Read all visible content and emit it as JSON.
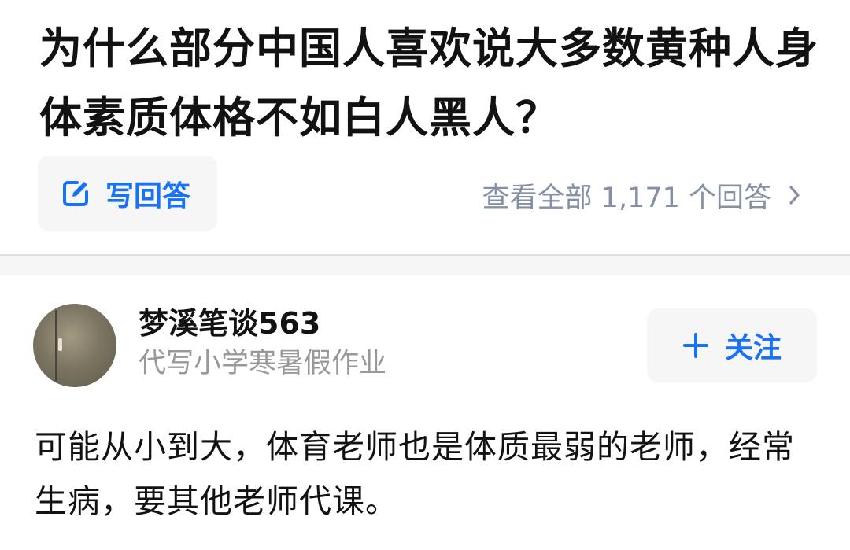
{
  "question": {
    "title": "为什么部分中国人喜欢说大多数黄种人身体素质体格不如白人黑人？"
  },
  "actions": {
    "write_answer_icon": "edit-icon",
    "write_answer_label": "写回答",
    "view_all_label": "查看全部 1,171 个回答",
    "view_all_icon": "chevron-right-icon"
  },
  "answer": {
    "author": {
      "name": "梦溪笔谈563",
      "bio": "代写小学寒暑假作业"
    },
    "follow": {
      "icon": "plus-icon",
      "label": "关注"
    },
    "content": "可能从小到大，体育老师也是体质最弱的老师，经常生病，要其他老师代课。"
  },
  "colors": {
    "accent": "#1772f6",
    "title_text": "#121212",
    "muted_text": "#8590a6",
    "bio_text": "#999999",
    "button_bg": "#f6f6f7",
    "divider_bg": "#f6f6f6"
  }
}
